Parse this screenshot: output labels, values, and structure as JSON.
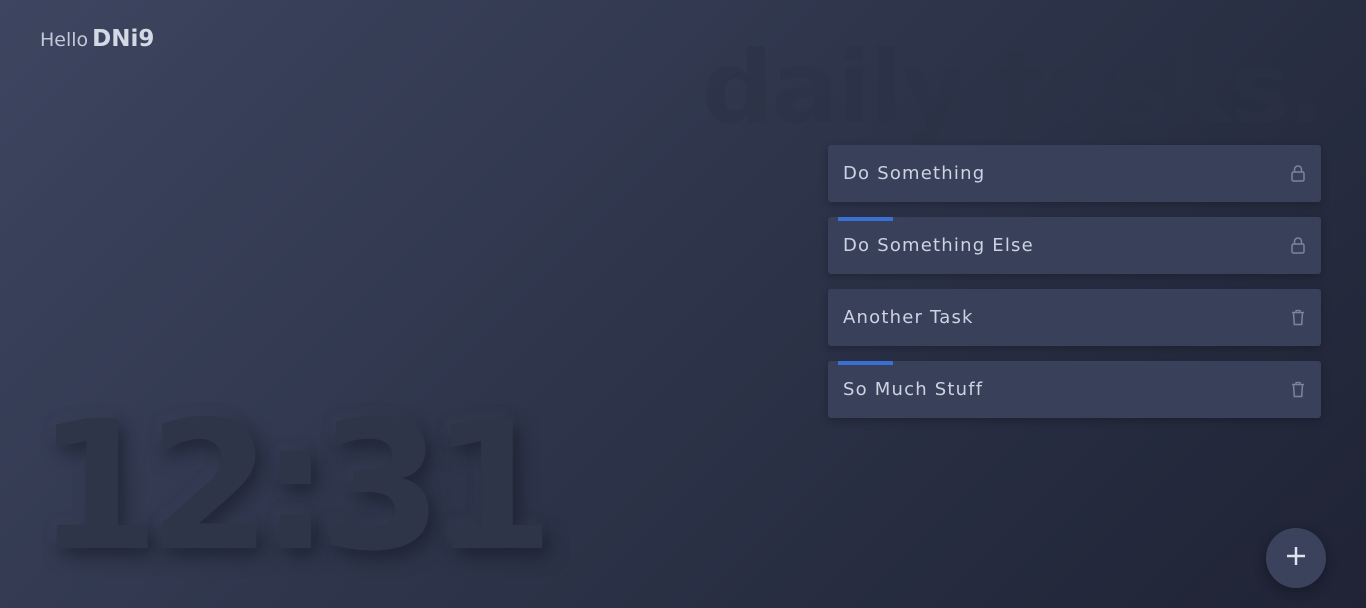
{
  "greeting": {
    "prefix": "Hello",
    "username": "DNi9"
  },
  "header": {
    "title": "daily tasks."
  },
  "clock": {
    "time": "12:31"
  },
  "tasks": [
    {
      "label": "Do Something",
      "action_icon": "lock-icon",
      "has_accent": false
    },
    {
      "label": "Do Something Else",
      "action_icon": "lock-icon",
      "has_accent": true
    },
    {
      "label": "Another Task",
      "action_icon": "trash-icon",
      "has_accent": false
    },
    {
      "label": "So Much Stuff",
      "action_icon": "trash-icon",
      "has_accent": true
    }
  ],
  "add_button": {
    "icon": "plus-icon"
  },
  "colors": {
    "accent": "#3b6fd4",
    "card": "#39415a",
    "icon": "#7d859c"
  }
}
